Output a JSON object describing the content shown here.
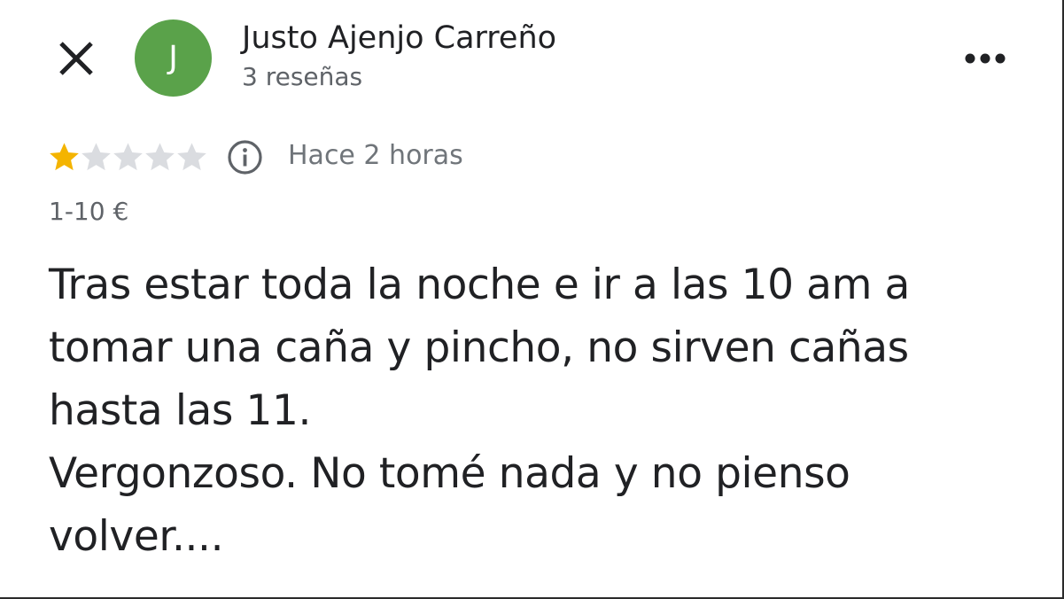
{
  "header": {
    "close_icon": "close-icon",
    "avatar_initial": "J",
    "avatar_color": "#5aa24a",
    "author_name": "Justo Ajenjo Carreño",
    "review_count": "3 reseñas",
    "more_icon": "more-horizontal-icon"
  },
  "rating": {
    "value": 1,
    "max": 5,
    "filled_color": "#f4b400",
    "empty_color": "#dadce0",
    "info_icon": "info-icon",
    "time": "Hace 2 horas"
  },
  "price_range": "1-10 €",
  "review": {
    "lines": [
      "Tras estar toda la noche e ir a las 10 am a",
      "tomar una caña y pincho, no sirven cañas",
      "hasta las 11.",
      "Vergonzoso. No tomé nada y no pienso",
      "volver...."
    ]
  }
}
